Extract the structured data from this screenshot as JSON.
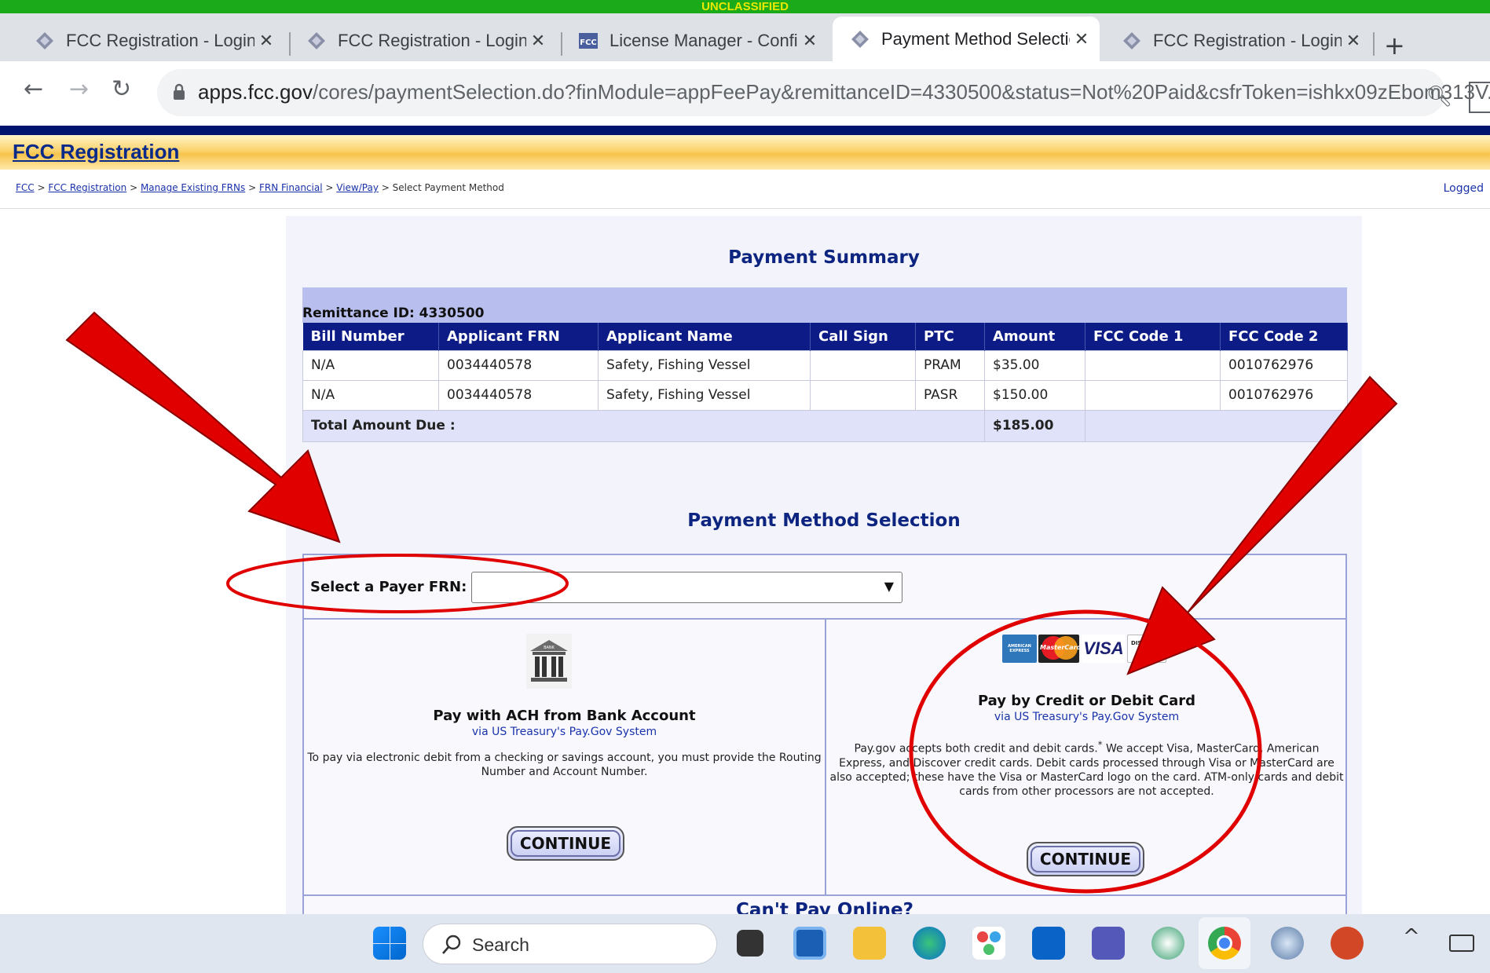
{
  "classification_banner": "UNCLASSIFIED",
  "tabs": [
    {
      "title": "FCC Registration - Login",
      "icon": "fcc-diamond-icon"
    },
    {
      "title": "FCC Registration - Login",
      "icon": "fcc-diamond-icon"
    },
    {
      "title": "License Manager - Confir",
      "icon": "fcc-logo-icon"
    },
    {
      "title": "Payment Method Selectio",
      "icon": "fcc-diamond-icon",
      "active": true
    },
    {
      "title": "FCC Registration - Login",
      "icon": "fcc-diamond-icon"
    }
  ],
  "new_tab_label": "+",
  "address_bar": {
    "host": "apps.fcc.gov",
    "path": "/cores/paymentSelection.do?finModule=appFeePay&remittanceID=4330500&status=Not%20Paid&csfrToken=ishkx09zEbom313V..."
  },
  "site_header": {
    "title": "FCC Registration"
  },
  "breadcrumb": {
    "links": [
      "FCC",
      "FCC Registration",
      "Manage Existing FRNs",
      "FRN Financial",
      "View/Pay"
    ],
    "current": "Select Payment Method",
    "separator": ">"
  },
  "logged_text": "Logged",
  "payment_summary": {
    "title": "Payment Summary",
    "remittance": "Remittance ID: 4330500",
    "columns": [
      "Bill Number",
      "Applicant FRN",
      "Applicant Name",
      "Call Sign",
      "PTC",
      "Amount",
      "FCC Code 1",
      "FCC Code 2"
    ],
    "rows": [
      [
        "N/A",
        "0034440578",
        "Safety, Fishing Vessel",
        "",
        "PRAM",
        "$35.00",
        "",
        "0010762976"
      ],
      [
        "N/A",
        "0034440578",
        "Safety, Fishing Vessel",
        "",
        "PASR",
        "$150.00",
        "",
        "0010762976"
      ]
    ],
    "total_label": "Total Amount Due :",
    "total_value": "$185.00"
  },
  "payment_method": {
    "title": "Payment Method Selection",
    "payer_label": "Select a Payer FRN:",
    "required_mark": "*",
    "payer_value": "",
    "ach": {
      "title": "Pay with ACH from Bank Account",
      "via": "via US Treasury's Pay.Gov System",
      "description": "To pay via electronic debit from a checking or savings account, you must provide the Routing Number and Account Number.",
      "button": "CONTINUE",
      "icon": "bank-icon"
    },
    "card": {
      "title": "Pay by Credit or Debit Card",
      "via": "via US Treasury's Pay.Gov System",
      "description_1": "Pay.gov accepts both credit and debit cards.",
      "footnote": "*",
      "description_2": " We accept Visa, MasterCard, American Express, and Discover credit cards. Debit cards processed through Visa or MasterCard are also accepted; these have the Visa or MasterCard logo on the card. ATM-only cards and debit cards from other processors are not accepted.",
      "button": "CONTINUE",
      "logos": [
        "AMERICAN EXPRESS",
        "MasterCard",
        "VISA",
        "DISCOVER"
      ]
    },
    "cant_pay": "Can't Pay Online?"
  },
  "taskbar": {
    "search_label": "Search",
    "icons": [
      "windows-start-icon",
      "search-icon",
      "task-view-icon",
      "widgets-icon",
      "file-explorer-icon",
      "edge-icon",
      "photos-icon",
      "outlook-icon",
      "teams-icon",
      "app-icon",
      "chrome-icon",
      "app-globe-icon",
      "powerpoint-icon",
      "chevron-up-icon",
      "keyboard-icon"
    ]
  },
  "colors": {
    "banner_green": "#1aaa1a",
    "fcc_navy": "#0d1b87",
    "annotation_red": "#e00000"
  }
}
